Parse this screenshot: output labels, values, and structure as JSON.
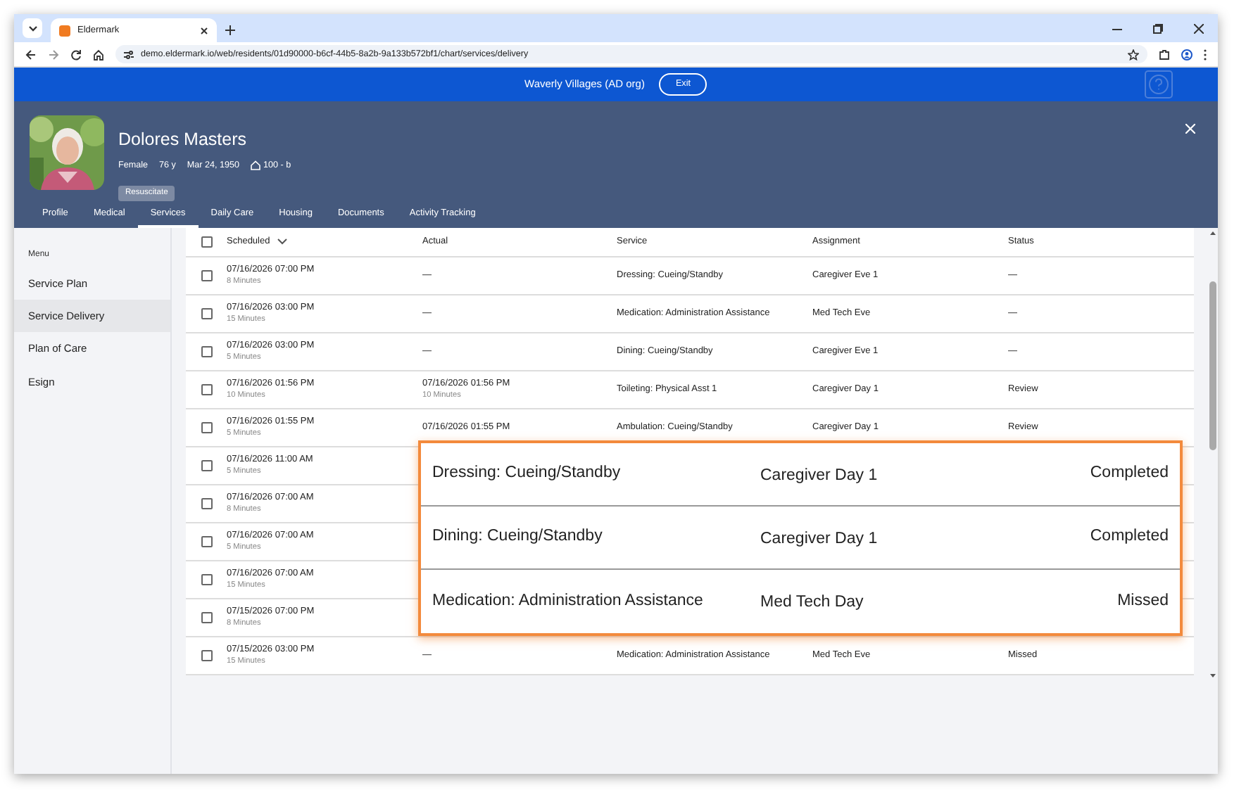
{
  "browser": {
    "tab_title": "Eldermark",
    "url": "demo.eldermark.io/web/residents/01d90000-b6cf-44b5-8a2b-9a133b572bf1/chart/services/delivery"
  },
  "banner": {
    "organization": "Waverly Villages (AD org)",
    "exit_button": "Exit"
  },
  "resident": {
    "name": "Dolores Masters",
    "gender": "Female",
    "age": "76 y",
    "birth_date": "Mar 24, 1950",
    "room": "100 - b",
    "code_status": "Resuscitate"
  },
  "tabs": [
    {
      "label": "Profile",
      "selected": false
    },
    {
      "label": "Medical",
      "selected": false
    },
    {
      "label": "Services",
      "selected": true
    },
    {
      "label": "Daily Care",
      "selected": false
    },
    {
      "label": "Housing",
      "selected": false
    },
    {
      "label": "Documents",
      "selected": false
    },
    {
      "label": "Activity Tracking",
      "selected": false
    }
  ],
  "sidebar": {
    "heading": "Menu",
    "items": [
      {
        "label": "Service Plan",
        "selected": false
      },
      {
        "label": "Service Delivery",
        "selected": true
      },
      {
        "label": "Plan of Care",
        "selected": false
      },
      {
        "label": "Esign",
        "selected": false
      }
    ]
  },
  "table": {
    "select_all_checked": false,
    "columns": [
      "Scheduled",
      "Actual",
      "Service",
      "Assignment",
      "Status"
    ],
    "rows": [
      {
        "checked": false,
        "scheduled": "07/16/2026 07:00 PM",
        "scheduled_duration": "8 Minutes",
        "actual": "—",
        "service": "Dressing: Cueing/Standby",
        "assignment": "Caregiver Eve 1",
        "status": "—"
      },
      {
        "checked": false,
        "scheduled": "07/16/2026 03:00 PM",
        "scheduled_duration": "15 Minutes",
        "actual": "—",
        "service": "Medication: Administration Assistance",
        "assignment": "Med Tech Eve",
        "status": "—"
      },
      {
        "checked": false,
        "scheduled": "07/16/2026 03:00 PM",
        "scheduled_duration": "5 Minutes",
        "actual": "—",
        "service": "Dining: Cueing/Standby",
        "assignment": "Caregiver Eve 1",
        "status": "—"
      },
      {
        "checked": false,
        "scheduled": "07/16/2026 01:56 PM",
        "scheduled_duration": "10 Minutes",
        "actual": "07/16/2026 01:56 PM",
        "actual_duration": "10 Minutes",
        "service": "Toileting: Physical Asst 1",
        "assignment": "Caregiver Day 1",
        "status": "Review"
      },
      {
        "checked": false,
        "scheduled": "07/16/2026 01:55 PM",
        "scheduled_duration": "5 Minutes",
        "actual": "07/16/2026 01:55 PM",
        "service": "Ambulation: Cueing/Standby",
        "assignment": "Caregiver Day 1",
        "status": "Review"
      },
      {
        "checked": false,
        "scheduled": "07/16/2026 11:00 AM",
        "scheduled_duration": "5 Minutes"
      },
      {
        "checked": false,
        "scheduled": "07/16/2026 07:00 AM",
        "scheduled_duration": "8 Minutes"
      },
      {
        "checked": false,
        "scheduled": "07/16/2026 07:00 AM",
        "scheduled_duration": "5 Minutes"
      },
      {
        "checked": false,
        "scheduled": "07/16/2026 07:00 AM",
        "scheduled_duration": "15 Minutes"
      },
      {
        "checked": false,
        "scheduled": "07/15/2026 07:00 PM",
        "scheduled_duration": "8 Minutes"
      },
      {
        "checked": false,
        "scheduled": "07/15/2026 03:00 PM",
        "scheduled_duration": "15 Minutes",
        "actual": "—",
        "service": "Medication: Administration Assistance",
        "assignment": "Med Tech Eve",
        "status": "Missed"
      }
    ]
  },
  "callout": {
    "rows": [
      {
        "service": "Dressing: Cueing/Standby",
        "assignment": "Caregiver Day 1",
        "status": "Completed"
      },
      {
        "service": "Dining: Cueing/Standby",
        "assignment": "Caregiver Day 1",
        "status": "Completed"
      },
      {
        "service": "Medication: Administration Assistance",
        "assignment": "Med Tech Day",
        "status": "Missed"
      }
    ]
  }
}
